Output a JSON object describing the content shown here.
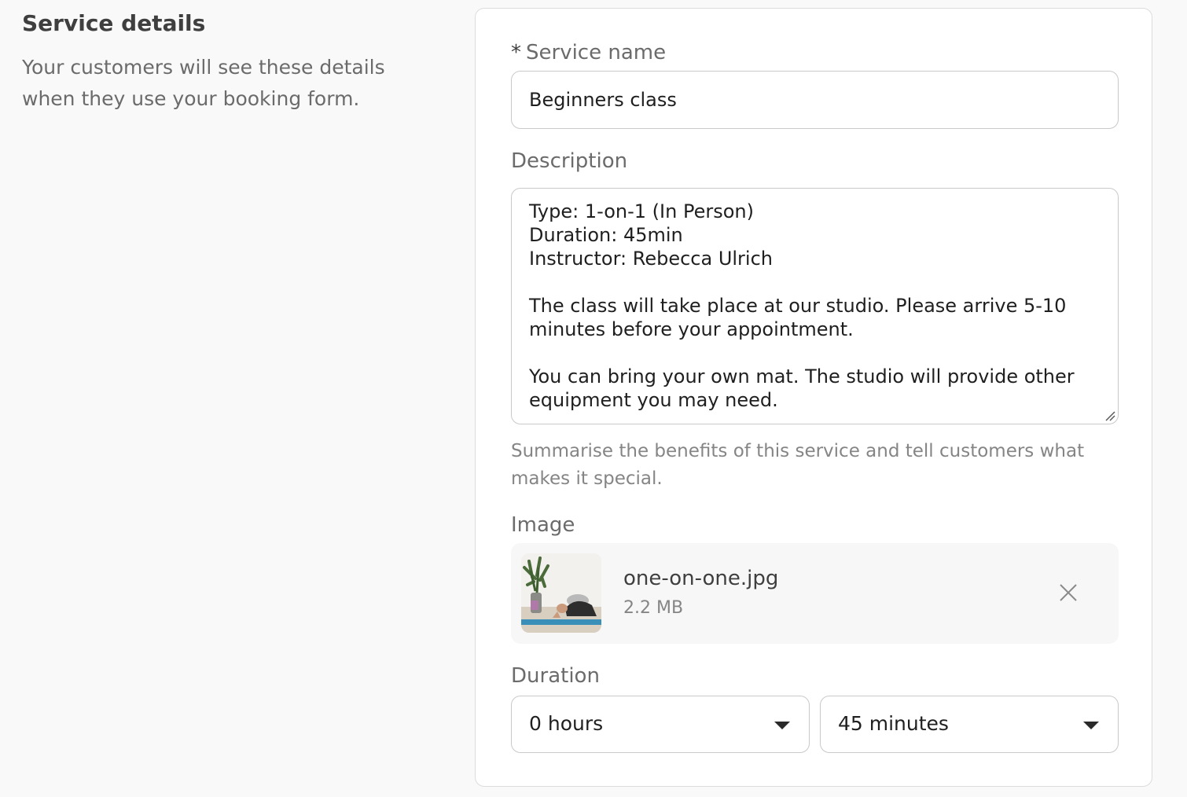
{
  "section": {
    "title": "Service details",
    "description": "Your customers will see these details when they use your booking form."
  },
  "service_name": {
    "required_marker": "*",
    "label": "Service name",
    "value": "Beginners class"
  },
  "description": {
    "label": "Description",
    "lines": [
      "Type: 1-on-1 (In Person)",
      "Duration: 45min",
      "Instructor: Rebecca Ulrich",
      "",
      "The class will take place at our studio. Please arrive 5-10",
      "minutes before your appointment.",
      "",
      "You can bring your own mat. The studio will provide other",
      "equipment you may need."
    ],
    "helper": "Summarise the benefits of this service and tell customers what makes it special."
  },
  "image": {
    "label": "Image",
    "file_name": "one-on-one.jpg",
    "file_size": "2.2 MB",
    "remove_icon": "close-icon"
  },
  "duration": {
    "label": "Duration",
    "hours": "0 hours",
    "minutes": "45 minutes",
    "dropdown_icon": "chevron-down-icon"
  },
  "colors": {
    "page_background": "#f9f9f9",
    "card_background": "#ffffff",
    "border": "#c9c9c9",
    "muted_text": "#6b6b6b"
  }
}
